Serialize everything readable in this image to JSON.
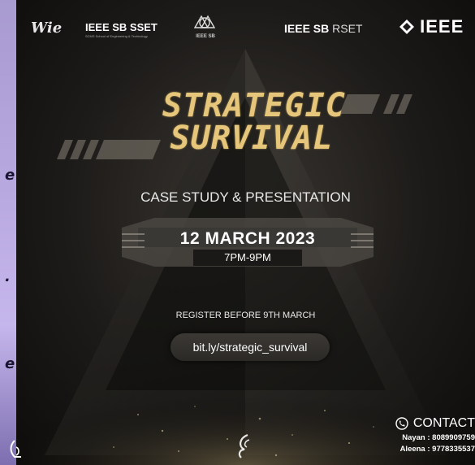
{
  "left_fragments": [
    "e",
    ".",
    "e"
  ],
  "logos": {
    "wie": "Wie",
    "sset": "IEEE SB SSET",
    "sset_sub": "SCMS School of Engineering & Technology",
    "sb": "IEEE SB",
    "rset_bold": "IEEE SB",
    "rset_light": " RSET",
    "ieee": "IEEE"
  },
  "event": {
    "title_line1": "STRATEGIC",
    "title_line2": "SURVIVAL",
    "subtitle": "CASE STUDY & PRESENTATION",
    "date": "12 MARCH 2023",
    "time": "7PM-9PM",
    "register_text": "REGISTER BEFORE 9TH MARCH",
    "link": "bit.ly/strategic_survival"
  },
  "contact": {
    "heading": "CONTACT",
    "lines": [
      "Nayan : 8089909759",
      "Aleena : 9778335537"
    ]
  },
  "icons": [
    "phone-icon",
    "ieee-diamond-icon",
    "wie-logo-icon",
    "ias-logo-icon"
  ],
  "colors": {
    "title_gold": "#e5c67a",
    "poster_bg": "#1d1b19",
    "strip": "#b8a8e0"
  }
}
